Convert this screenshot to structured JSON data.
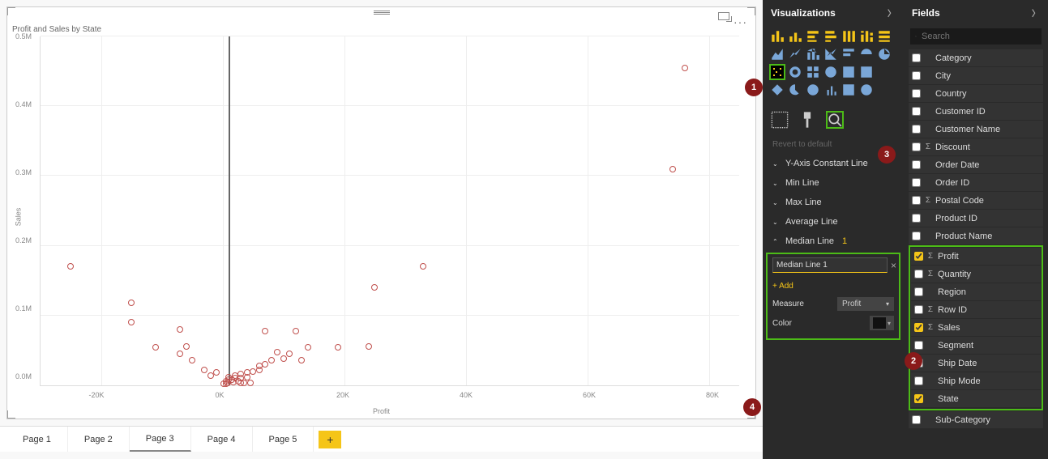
{
  "chart": {
    "title": "Profit and Sales by State",
    "xlabel": "Profit",
    "ylabel": "Sales",
    "yticks": [
      "0.5M",
      "0.4M",
      "0.3M",
      "0.2M",
      "0.1M",
      "0.0M"
    ],
    "xticks": [
      "-20K",
      "0K",
      "20K",
      "40K",
      "60K",
      "80K"
    ]
  },
  "chart_data": {
    "type": "scatter",
    "title": "Profit and Sales by State",
    "xlabel": "Profit",
    "ylabel": "Sales",
    "xlim": [
      -30000,
      85000
    ],
    "ylim": [
      0,
      500000
    ],
    "median_line_x": 1000,
    "series": [
      {
        "name": "States",
        "points": [
          {
            "x": 76000,
            "y": 455000
          },
          {
            "x": 74000,
            "y": 310000
          },
          {
            "x": -25000,
            "y": 170000
          },
          {
            "x": 33000,
            "y": 170000
          },
          {
            "x": 25000,
            "y": 140000
          },
          {
            "x": -15000,
            "y": 118000
          },
          {
            "x": -15000,
            "y": 90000
          },
          {
            "x": -7000,
            "y": 80000
          },
          {
            "x": 7000,
            "y": 78000
          },
          {
            "x": -6000,
            "y": 56000
          },
          {
            "x": 12000,
            "y": 78000
          },
          {
            "x": 24000,
            "y": 56000
          },
          {
            "x": 19000,
            "y": 55000
          },
          {
            "x": 14000,
            "y": 55000
          },
          {
            "x": 10000,
            "y": 38000
          },
          {
            "x": 8000,
            "y": 36000
          },
          {
            "x": 13000,
            "y": 36000
          },
          {
            "x": 11000,
            "y": 45000
          },
          {
            "x": 9000,
            "y": 48000
          },
          {
            "x": -5000,
            "y": 36000
          },
          {
            "x": -11000,
            "y": 55000
          },
          {
            "x": -7000,
            "y": 45000
          },
          {
            "x": 7000,
            "y": 30000
          },
          {
            "x": 6000,
            "y": 28000
          },
          {
            "x": 4000,
            "y": 19000
          },
          {
            "x": -3000,
            "y": 22000
          },
          {
            "x": -1000,
            "y": 18000
          },
          {
            "x": 6000,
            "y": 22000
          },
          {
            "x": 5000,
            "y": 20000
          },
          {
            "x": -2000,
            "y": 14000
          },
          {
            "x": 3000,
            "y": 16000
          },
          {
            "x": 2000,
            "y": 14000
          },
          {
            "x": 4000,
            "y": 12000
          },
          {
            "x": 3000,
            "y": 10000
          },
          {
            "x": 1000,
            "y": 12000
          },
          {
            "x": 2000,
            "y": 10000
          },
          {
            "x": 1500,
            "y": 8000
          },
          {
            "x": 1000,
            "y": 8000
          },
          {
            "x": 500,
            "y": 6000
          },
          {
            "x": 2500,
            "y": 6000
          },
          {
            "x": 1800,
            "y": 5000
          },
          {
            "x": 800,
            "y": 4000
          },
          {
            "x": 3500,
            "y": 4000
          },
          {
            "x": 3000,
            "y": 3000
          },
          {
            "x": 4500,
            "y": 3000
          },
          {
            "x": 200,
            "y": 2000
          },
          {
            "x": 600,
            "y": 2000
          }
        ]
      }
    ]
  },
  "pages": {
    "tabs": [
      "Page 1",
      "Page 2",
      "Page 3",
      "Page 4",
      "Page 5"
    ],
    "active": "Page 3",
    "add": "+"
  },
  "viz": {
    "header": "Visualizations",
    "revert": "Revert to default",
    "analytics": {
      "yaxis": "Y-Axis Constant Line",
      "min": "Min Line",
      "max": "Max Line",
      "avg": "Average Line",
      "median": "Median Line",
      "median_count": "1",
      "line_name": "Median Line 1",
      "add": "+ Add",
      "measure_label": "Measure",
      "measure_value": "Profit",
      "color_label": "Color"
    }
  },
  "fields": {
    "header": "Fields",
    "search_placeholder": "Search",
    "items": [
      {
        "name": "Category",
        "checked": false,
        "sigma": false
      },
      {
        "name": "City",
        "checked": false,
        "sigma": false
      },
      {
        "name": "Country",
        "checked": false,
        "sigma": false
      },
      {
        "name": "Customer ID",
        "checked": false,
        "sigma": false
      },
      {
        "name": "Customer Name",
        "checked": false,
        "sigma": false
      },
      {
        "name": "Discount",
        "checked": false,
        "sigma": true
      },
      {
        "name": "Order Date",
        "checked": false,
        "sigma": false
      },
      {
        "name": "Order ID",
        "checked": false,
        "sigma": false
      },
      {
        "name": "Postal Code",
        "checked": false,
        "sigma": true
      },
      {
        "name": "Product ID",
        "checked": false,
        "sigma": false
      },
      {
        "name": "Product Name",
        "checked": false,
        "sigma": false
      },
      {
        "name": "Profit",
        "checked": true,
        "sigma": true
      },
      {
        "name": "Quantity",
        "checked": false,
        "sigma": true
      },
      {
        "name": "Region",
        "checked": false,
        "sigma": false
      },
      {
        "name": "Row ID",
        "checked": false,
        "sigma": true
      },
      {
        "name": "Sales",
        "checked": true,
        "sigma": true
      },
      {
        "name": "Segment",
        "checked": false,
        "sigma": false
      },
      {
        "name": "Ship Date",
        "checked": false,
        "sigma": false
      },
      {
        "name": "Ship Mode",
        "checked": false,
        "sigma": false
      },
      {
        "name": "State",
        "checked": true,
        "sigma": false
      },
      {
        "name": "Sub-Category",
        "checked": false,
        "sigma": false
      }
    ]
  },
  "callouts": {
    "1": "1",
    "2": "2",
    "3": "3",
    "4": "4"
  }
}
